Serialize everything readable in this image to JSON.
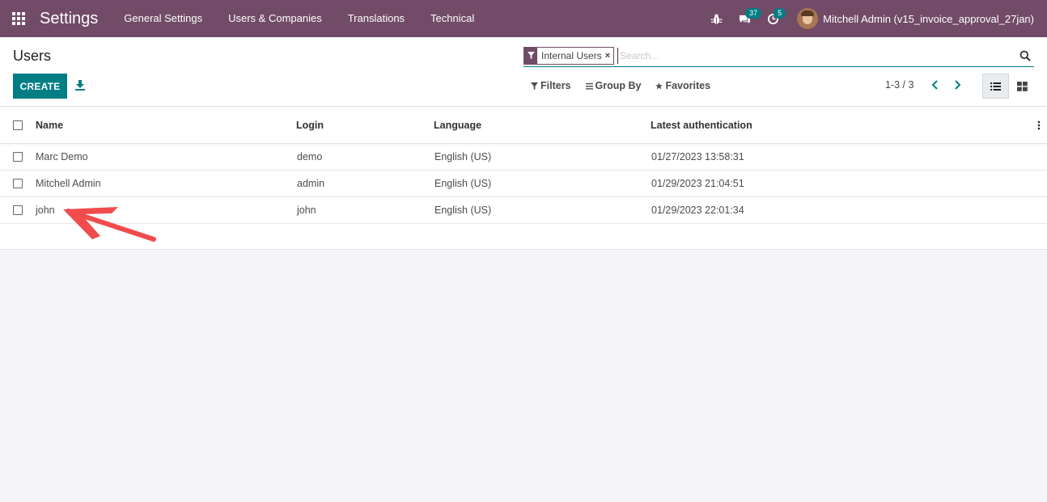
{
  "navbar": {
    "app_title": "Settings",
    "menu": [
      "General Settings",
      "Users & Companies",
      "Translations",
      "Technical"
    ],
    "messages_badge": "37",
    "activities_badge": "5",
    "user_name": "Mitchell Admin (v15_invoice_approval_27jan)"
  },
  "control_panel": {
    "title": "Users",
    "create_label": "CREATE",
    "facet_label": "Internal Users",
    "facet_remove": "×",
    "search_placeholder": "Search...",
    "filters_label": "Filters",
    "group_by_label": "Group By",
    "favorites_label": "Favorites",
    "pager_value": "1-3 / 3"
  },
  "list": {
    "columns": [
      "Name",
      "Login",
      "Language",
      "Latest authentication"
    ],
    "rows": [
      {
        "name": "Marc Demo",
        "login": "demo",
        "language": "English (US)",
        "latest_auth": "01/27/2023 13:58:31"
      },
      {
        "name": "Mitchell Admin",
        "login": "admin",
        "language": "English (US)",
        "latest_auth": "01/29/2023 21:04:51"
      },
      {
        "name": "john",
        "login": "john",
        "language": "English (US)",
        "latest_auth": "01/29/2023 22:01:34"
      }
    ]
  },
  "colors": {
    "navbar": "#714b67",
    "primary": "#017e84",
    "annotation_arrow": "#f04c4c"
  }
}
